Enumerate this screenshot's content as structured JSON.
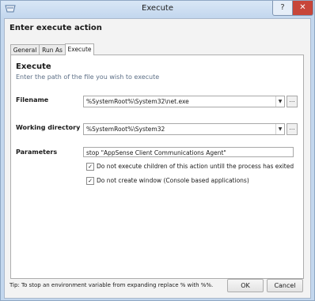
{
  "window": {
    "title": "Execute",
    "help_label": "?",
    "close_label": "✕"
  },
  "dialog": {
    "heading": "Enter execute action"
  },
  "tabs": [
    {
      "label": "General",
      "active": false
    },
    {
      "label": "Run As",
      "active": false
    },
    {
      "label": "Execute",
      "active": true
    }
  ],
  "panel": {
    "title": "Execute",
    "description": "Enter the path of the file you wish to execute"
  },
  "fields": {
    "filename": {
      "label": "Filename",
      "value": "%SystemRoot%\\System32\\net.exe"
    },
    "working_directory": {
      "label": "Working directory",
      "value": "%SystemRoot%\\System32"
    },
    "parameters": {
      "label": "Parameters",
      "value": "stop \"AppSense Client Communications Agent\""
    }
  },
  "browse_label": "…",
  "dropdown_glyph": "▼",
  "checkboxes": [
    {
      "label": "Do not execute children of this action untill the process has exited",
      "checked": true,
      "glyph": "✓"
    },
    {
      "label": "Do not create window (Console based applications)",
      "checked": true,
      "glyph": "✓"
    }
  ],
  "footer": {
    "tip": "Tip: To stop an environment variable from expanding replace % with %%.",
    "ok_label": "OK",
    "cancel_label": "Cancel"
  },
  "colors": {
    "frame": "#c3d7ee",
    "close_button": "#c7463a",
    "description_text": "#5d6f86"
  },
  "icons": [
    "window-app-icon",
    "dropdown-arrow-icon",
    "ellipsis-browse-icon",
    "checkmark-icon"
  ]
}
